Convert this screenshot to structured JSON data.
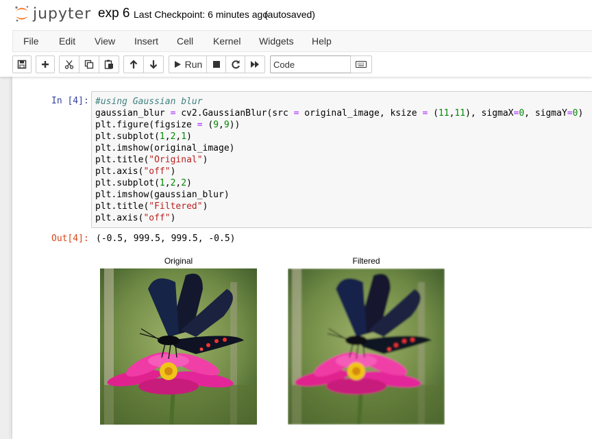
{
  "header": {
    "logo_text": "jupyter",
    "notebook_name": "exp 6",
    "checkpoint": "Last Checkpoint: 6 minutes ago",
    "autosave_status": "(autosaved)"
  },
  "menu": [
    "File",
    "Edit",
    "View",
    "Insert",
    "Cell",
    "Kernel",
    "Widgets",
    "Help"
  ],
  "toolbar": {
    "icons": [
      "save-icon",
      "plus-icon",
      "cut-icon",
      "copy-icon",
      "paste-icon",
      "arrow-up-icon",
      "arrow-down-icon",
      "play-icon",
      "stop-icon",
      "restart-icon",
      "fast-forward-icon",
      "keyboard-icon"
    ],
    "run_label": "Run",
    "cell_type": "Code"
  },
  "cell": {
    "in_prompt": "In [4]:",
    "out_prompt": "Out[4]:",
    "code_lines": [
      "#using Gaussian blur",
      "gaussian_blur = cv2.GaussianBlur(src = original_image, ksize = (11,11), sigmaX=0, sigmaY=0)",
      "plt.figure(figsize = (9,9))",
      "plt.subplot(1,2,1)",
      "plt.imshow(original_image)",
      "plt.title(\"Original\")",
      "plt.axis(\"off\")",
      "plt.subplot(1,2,2)",
      "plt.imshow(gaussian_blur)",
      "plt.title(\"Filtered\")",
      "plt.axis(\"off\")"
    ],
    "output_text": "(-0.5, 999.5, 999.5, -0.5)"
  },
  "figure": {
    "left_title": "Original",
    "right_title": "Filtered"
  },
  "colors": {
    "in_prompt": "#303f9f",
    "out_prompt": "#d84315",
    "logo_orange": "#f37726"
  }
}
